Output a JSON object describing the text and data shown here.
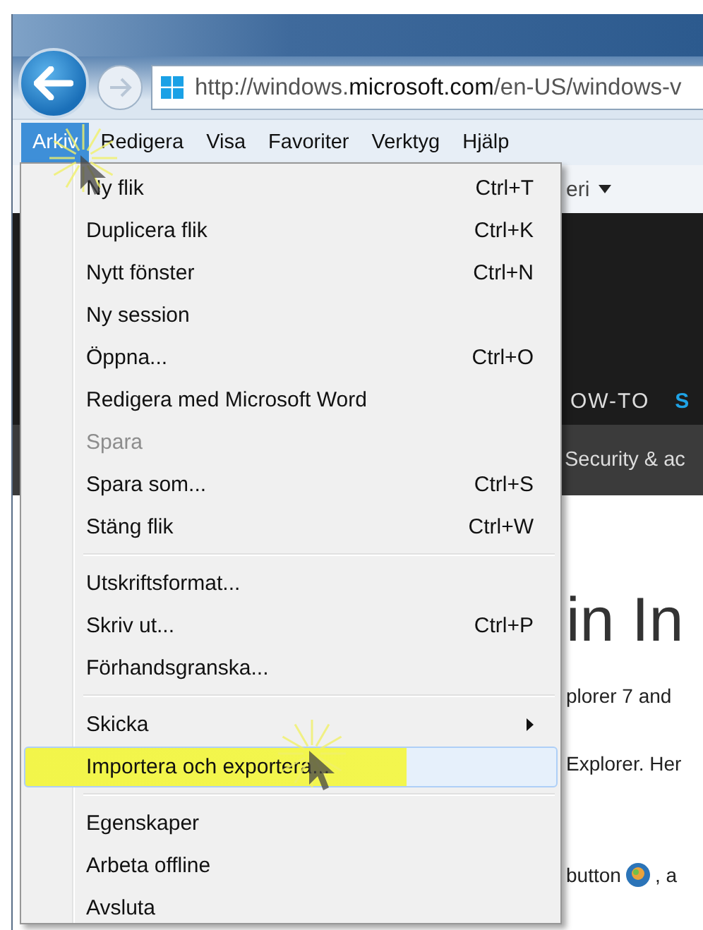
{
  "address_bar": {
    "url": "http://windows.**microsoft.com**/en-US/windows-v"
  },
  "menu_bar": [
    {
      "label": "Arkiv",
      "selected": true
    },
    {
      "label": "Redigera",
      "selected": false
    },
    {
      "label": "Visa",
      "selected": false
    },
    {
      "label": "Favoriter",
      "selected": false
    },
    {
      "label": "Verktyg",
      "selected": false
    },
    {
      "label": "Hjälp",
      "selected": false
    }
  ],
  "menu": {
    "groups": [
      [
        {
          "label": "Ny flik",
          "shortcut": "Ctrl+T",
          "disabled": false,
          "submenu": false,
          "selected": false
        },
        {
          "label": "Duplicera flik",
          "shortcut": "Ctrl+K",
          "disabled": false,
          "submenu": false,
          "selected": false
        },
        {
          "label": "Nytt fönster",
          "shortcut": "Ctrl+N",
          "disabled": false,
          "submenu": false,
          "selected": false
        },
        {
          "label": "Ny session",
          "disabled": false,
          "submenu": false,
          "selected": false
        },
        {
          "label": "Öppna...",
          "shortcut": "Ctrl+O",
          "disabled": false,
          "submenu": false,
          "selected": false
        },
        {
          "label": "Redigera med Microsoft Word",
          "disabled": false,
          "submenu": false,
          "selected": false
        },
        {
          "label": "Spara",
          "disabled": true,
          "submenu": false,
          "selected": false
        },
        {
          "label": "Spara som...",
          "shortcut": "Ctrl+S",
          "disabled": false,
          "submenu": false,
          "selected": false
        },
        {
          "label": "Stäng flik",
          "shortcut": "Ctrl+W",
          "disabled": false,
          "submenu": false,
          "selected": false
        }
      ],
      [
        {
          "label": "Utskriftsformat...",
          "disabled": false,
          "submenu": false,
          "selected": false
        },
        {
          "label": "Skriv ut...",
          "shortcut": "Ctrl+P",
          "disabled": false,
          "submenu": false,
          "selected": false
        },
        {
          "label": "Förhandsgranska...",
          "disabled": false,
          "submenu": false,
          "selected": false
        }
      ],
      [
        {
          "label": "Skicka",
          "disabled": false,
          "submenu": true,
          "selected": false
        },
        {
          "label": "Importera och exportera...",
          "disabled": false,
          "submenu": false,
          "selected": true
        }
      ],
      [
        {
          "label": "Egenskaper",
          "disabled": false,
          "submenu": false,
          "selected": false
        },
        {
          "label": "Arbeta offline",
          "disabled": false,
          "submenu": false,
          "selected": false
        },
        {
          "label": "Avsluta",
          "disabled": false,
          "submenu": false,
          "selected": false
        }
      ]
    ]
  },
  "toolbar": {
    "text": "eri"
  },
  "page": {
    "nav_items": [
      {
        "label": "OW-TO",
        "selected": false
      },
      {
        "label": "S",
        "selected": true
      }
    ],
    "subnav": "Security & ac",
    "heading": "in In",
    "paragraphs": [
      "plorer 7 and",
      "Explorer. Her"
    ],
    "button_line": {
      "before": "button",
      "after": ", a"
    }
  }
}
